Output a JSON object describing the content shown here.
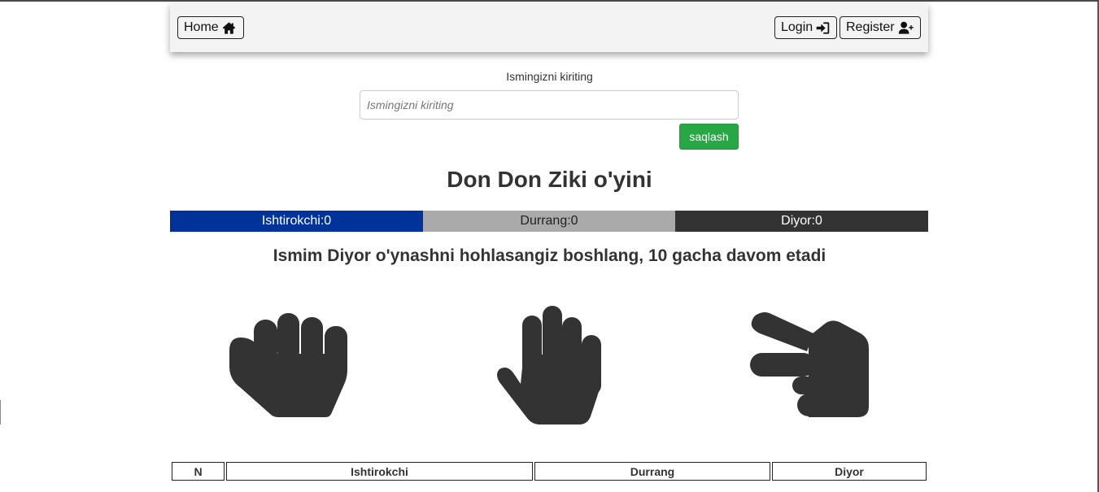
{
  "nav": {
    "home_label": "Home",
    "login_label": "Login",
    "register_label": "Register",
    "home_icon": "home-icon",
    "login_icon": "sign-in-icon",
    "register_icon": "user-plus-icon"
  },
  "name_form": {
    "label": "Ismingizni kiriting",
    "placeholder": "Ismingizni kiriting",
    "value": "",
    "save_label": "saqlash"
  },
  "game": {
    "title": "Don Don Ziki o'yini",
    "intro": "Ismim Diyor o'ynashni hohlasangiz boshlang, 10 gacha davom etadi"
  },
  "scores": {
    "player": "Ishtirokchi:0",
    "draw": "Durrang:0",
    "bot": "Diyor:0"
  },
  "choices": [
    {
      "name": "rock",
      "icon": "hand-rock-icon"
    },
    {
      "name": "paper",
      "icon": "hand-paper-icon"
    },
    {
      "name": "scissors",
      "icon": "hand-scissors-icon"
    }
  ],
  "table": {
    "headers": [
      "N",
      "Ishtirokchi",
      "Durrang",
      "Diyor"
    ],
    "rows": []
  },
  "colors": {
    "player": "#003399",
    "draw": "#aaaaaa",
    "bot": "#333333",
    "save_button": "#28a745",
    "icons": "#333333"
  }
}
